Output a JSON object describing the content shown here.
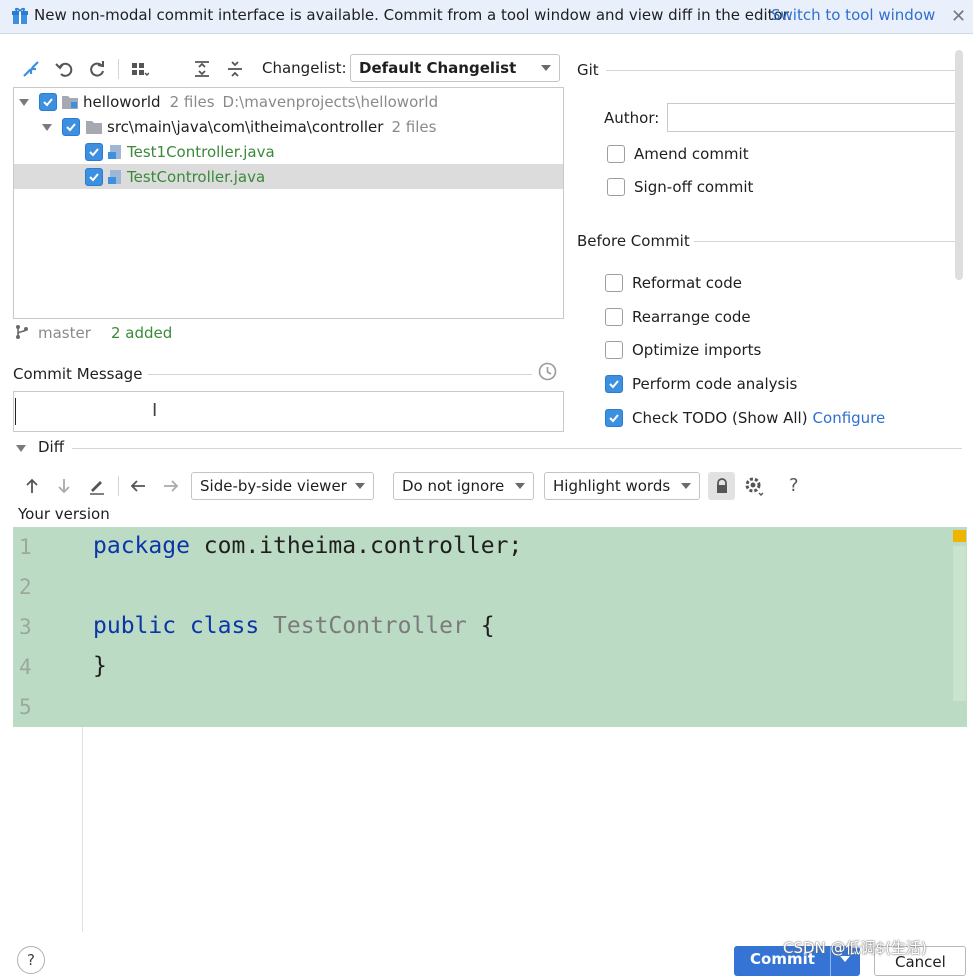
{
  "banner": {
    "text": "New non-modal commit interface is available. Commit from a tool window and view diff in the editor.",
    "link": "Switch to tool window"
  },
  "toolbar": {
    "changelist_label": "Changelist:",
    "changelist_value": "Default Changelist"
  },
  "tree": {
    "root": {
      "name": "helloworld",
      "count": "2 files",
      "path": "D:\\mavenprojects\\helloworld"
    },
    "folder": {
      "name": "src\\main\\java\\com\\itheima\\controller",
      "count": "2 files"
    },
    "files": [
      {
        "name": "Test1Controller.java"
      },
      {
        "name": "TestController.java"
      }
    ]
  },
  "status": {
    "branch": "master",
    "added": "2 added"
  },
  "commit_message": {
    "label": "Commit Message",
    "value": ""
  },
  "git": {
    "title": "Git",
    "author_label": "Author:",
    "author_value": "",
    "amend_label": "Amend commit",
    "signoff_label": "Sign-off commit"
  },
  "before_commit": {
    "title": "Before Commit",
    "options": [
      {
        "label": "Reformat code",
        "checked": false
      },
      {
        "label": "Rearrange code",
        "checked": false
      },
      {
        "label": "Optimize imports",
        "checked": false
      },
      {
        "label": "Perform code analysis",
        "checked": true
      },
      {
        "label": "Check TODO (Show All)",
        "checked": true,
        "link": "Configure"
      }
    ]
  },
  "diff": {
    "title": "Diff",
    "viewer": "Side-by-side viewer",
    "whitespace": "Do not ignore",
    "highlight": "Highlight words",
    "help": "?",
    "your_version": "Your version",
    "line_numbers": [
      "1",
      "2",
      "3",
      "4",
      "5"
    ],
    "code": {
      "l1_kw": "package",
      "l1_rest": " com.itheima.controller;",
      "l3_kw": "public class",
      "l3_cls": " TestController",
      "l3_rest": " {",
      "l4": "}"
    }
  },
  "footer": {
    "help": "?",
    "commit": "Commit",
    "cancel": "Cancel",
    "watermark": "CSDN @低调$(生活)"
  },
  "colors": {
    "accent": "#3d8fe0",
    "added_bg": "#bcdbc4",
    "link": "#2e6fd1"
  }
}
